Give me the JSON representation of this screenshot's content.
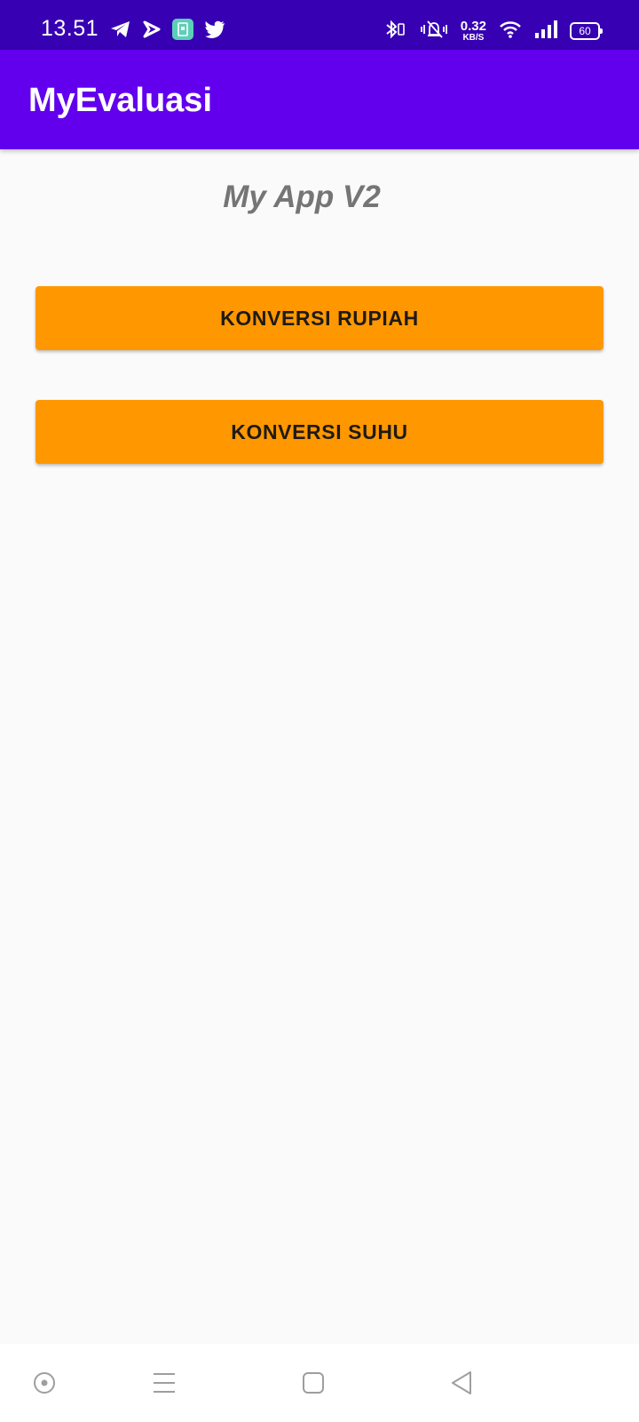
{
  "status_bar": {
    "time": "13.51",
    "left_icons": [
      "telegram-icon",
      "navigation-app-icon",
      "app-notification-icon",
      "twitter-icon"
    ],
    "right_icons": [
      "bluetooth-icon",
      "vibrate-silent-icon",
      "network-speed",
      "wifi-icon",
      "signal-icon",
      "battery-icon"
    ],
    "network_speed_value": "0.32",
    "network_speed_unit": "KB/S",
    "battery_level": "60"
  },
  "app_bar": {
    "title": "MyEvaluasi"
  },
  "main": {
    "subtitle": "My App V2",
    "buttons": [
      {
        "label": "KONVERSI RUPIAH"
      },
      {
        "label": "KONVERSI SUHU"
      }
    ]
  },
  "nav_bar": {
    "icons": [
      "assistant-icon",
      "menu-icon",
      "home-icon",
      "back-icon"
    ]
  },
  "colors": {
    "status_bar": "#3700b3",
    "app_bar": "#6200ee",
    "button": "#ff9800",
    "background": "#fafafa",
    "subtitle": "#757575"
  }
}
